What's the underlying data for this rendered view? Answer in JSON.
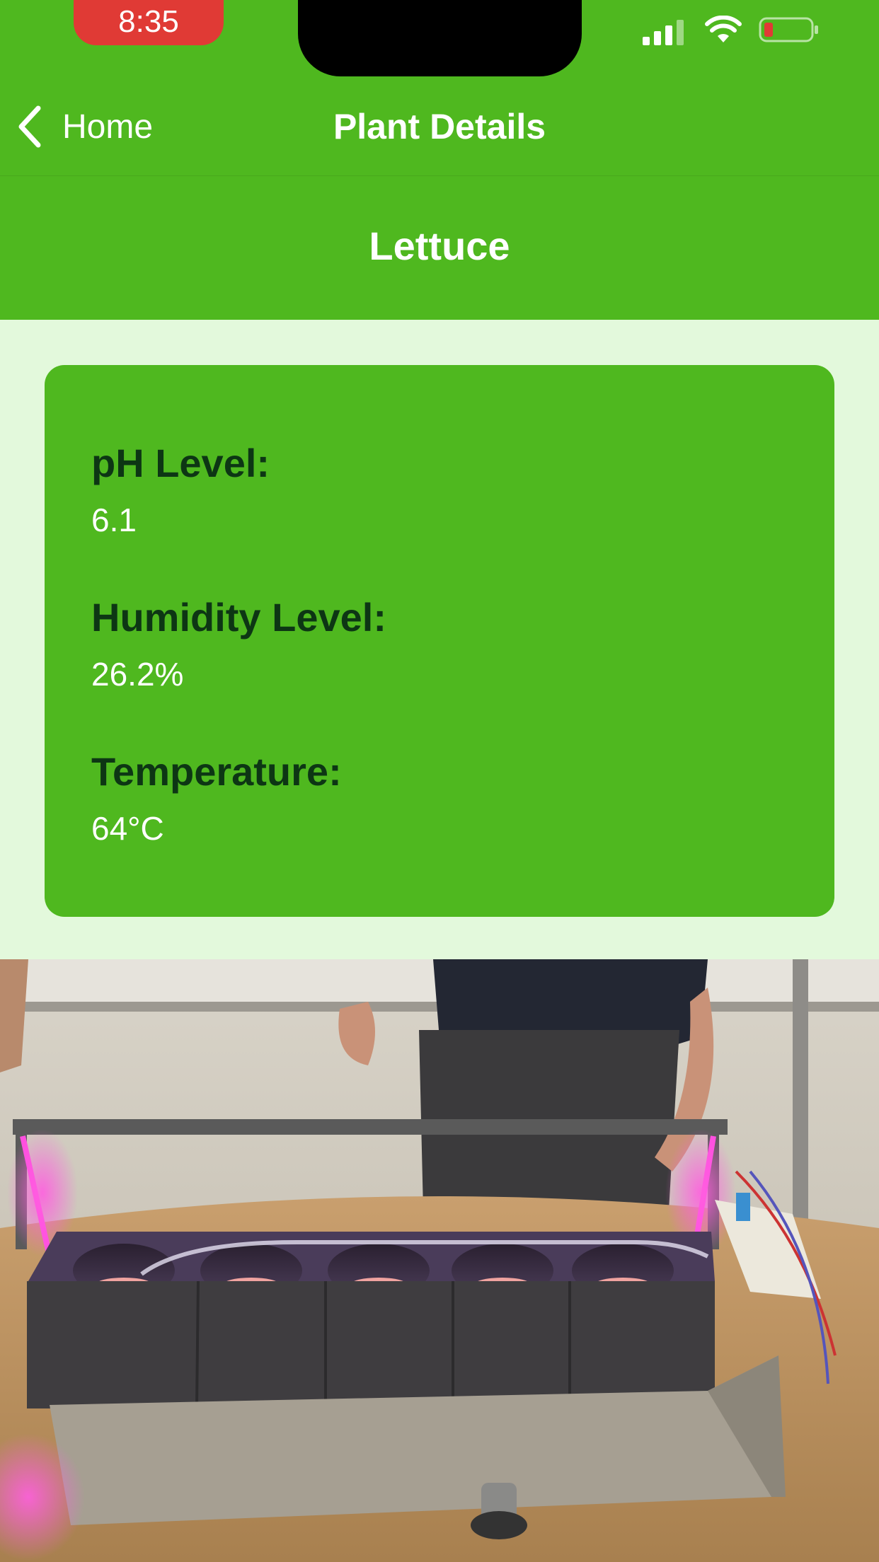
{
  "status_bar": {
    "time": "8:35",
    "icons": [
      "signal-icon",
      "wifi-icon",
      "battery-low-icon"
    ],
    "battery_color": "#e03a35"
  },
  "nav": {
    "back_label": "Home",
    "title": "Plant Details"
  },
  "plant": {
    "name": "Lettuce"
  },
  "metrics": {
    "ph_label": "pH Level:",
    "ph_value": "6.1",
    "humidity_label": "Humidity Level:",
    "humidity_value": "26.2%",
    "temperature_label": "Temperature:",
    "temperature_value": "64°C"
  },
  "colors": {
    "brand_green": "#4fb81f",
    "background": "#e3f9dc",
    "label_dark": "#0d3614"
  }
}
